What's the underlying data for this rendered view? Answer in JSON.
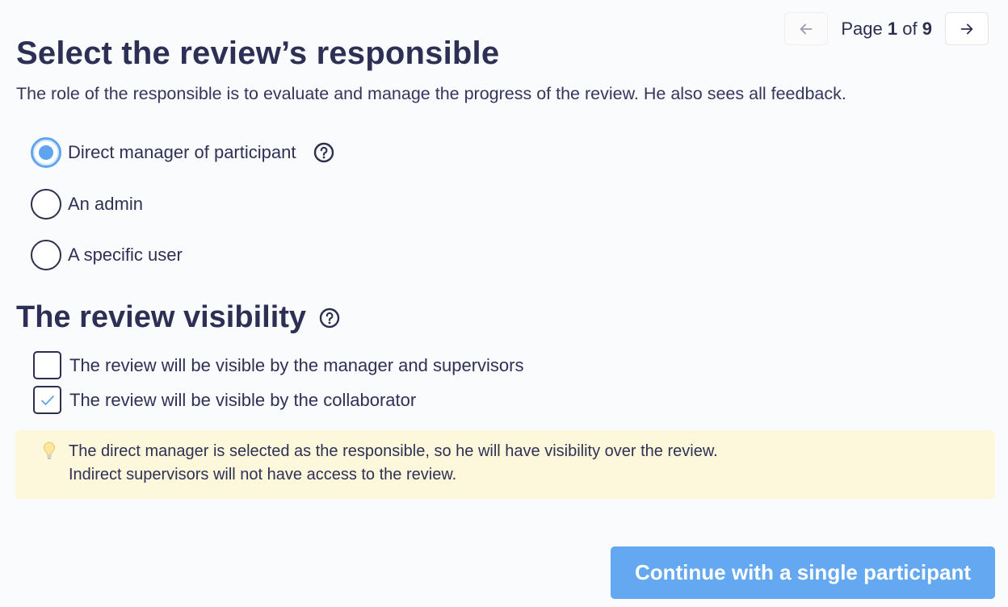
{
  "pagination": {
    "prefix": "Page",
    "current": "1",
    "separator": "of",
    "total": "9",
    "prev_icon": "arrow-left-icon",
    "next_icon": "arrow-right-icon",
    "prev_disabled": true
  },
  "responsible": {
    "title": "Select the review’s responsible",
    "description": "The role of the responsible is to evaluate and manage the progress of the review. He also sees all feedback.",
    "options": [
      {
        "label": "Direct manager of participant",
        "checked": true,
        "has_help": true
      },
      {
        "label": "An admin",
        "checked": false
      },
      {
        "label": "A specific user",
        "checked": false
      }
    ]
  },
  "visibility": {
    "title": "The review visibility",
    "options": [
      {
        "label": "The review will be visible by the manager and supervisors",
        "checked": false
      },
      {
        "label": "The review will be visible by the collaborator",
        "checked": true
      }
    ]
  },
  "notice": {
    "icon": "lightbulb-icon",
    "line1": "The direct manager is selected as the responsible, so he will have visibility over the review.",
    "line2": "Indirect supervisors will not have access to the review."
  },
  "actions": {
    "continue_label": "Continue with a single participant"
  },
  "colors": {
    "accent": "#5ea4ef",
    "button": "#64a8f2",
    "text": "#2c2f4e",
    "notice_bg": "#fdf7dc"
  }
}
